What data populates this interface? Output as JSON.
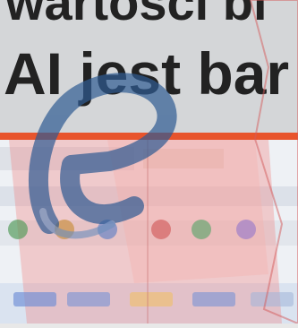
{
  "headline": {
    "line1": "wartości bi",
    "line2": "AI jest bar"
  },
  "colors": {
    "accent": "#e8542c",
    "headline_text": "#222222",
    "logo_blue": "#2f5b93",
    "overlay_red": "#f08080"
  },
  "icons": {
    "logo": "e-logo-icon"
  }
}
